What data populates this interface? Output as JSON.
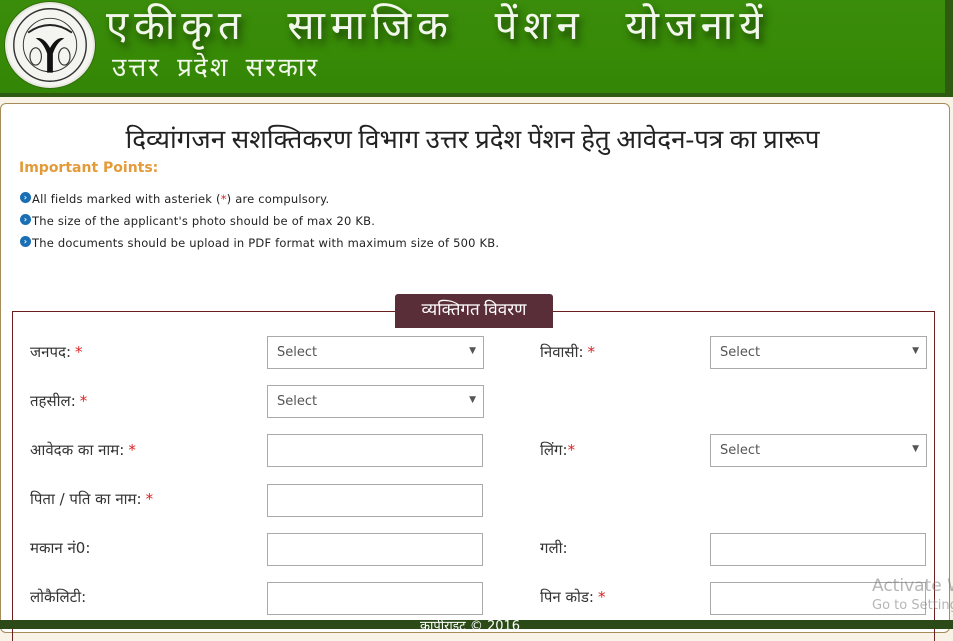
{
  "header": {
    "title": "एकीकृत सामाजिक पेंशन योजनायें",
    "subtitle": "उत्तर प्रदेश सरकार",
    "emblem": "up-government-emblem"
  },
  "page": {
    "title": "दिव्यांगजन सशक्तिकरण विभाग उत्तर प्रदेश पेंशन हेतु आवेदन-पत्र का प्रारूप"
  },
  "important_points": {
    "heading": "Important Points:",
    "bullet_icon": "chevron-right-circle-icon",
    "items": [
      {
        "before": "All fields marked with asteriek ( ",
        "star": "*",
        "after": " ) are compulsory."
      },
      {
        "before": "The size of the applicant's photo should be of max 20 KB.",
        "star": "",
        "after": ""
      },
      {
        "before": "The documents should be upload in PDF format with maximum size of 500 KB.",
        "star": "",
        "after": ""
      }
    ]
  },
  "section": {
    "legend": "व्यक्तिगत विवरण",
    "required_marker": "*",
    "caret": "▼",
    "fields": {
      "janpad": {
        "label": "जनपद:",
        "type": "select",
        "value": "Select",
        "required": true
      },
      "niwasi": {
        "label": "निवासी:",
        "type": "select",
        "value": "Select",
        "required": true
      },
      "tehsil": {
        "label": "तहसील:",
        "type": "select",
        "value": "Select",
        "required": true
      },
      "applicant_name": {
        "label": "आवेदक का नाम:",
        "type": "text",
        "value": "",
        "required": true
      },
      "gender": {
        "label": "लिंग:",
        "type": "select",
        "value": "Select",
        "required": true
      },
      "father_husband_name": {
        "label": "पिता / पति का नाम:",
        "type": "text",
        "value": "",
        "required": true
      },
      "house_no": {
        "label": "मकान नं0:",
        "type": "text",
        "value": "",
        "required": false
      },
      "street": {
        "label": "गली:",
        "type": "text",
        "value": "",
        "required": false
      },
      "locality": {
        "label": "लोकैलिटी:",
        "type": "text",
        "value": "",
        "required": false
      },
      "pin_code": {
        "label": "पिन कोड:",
        "type": "text",
        "value": "",
        "required": true
      }
    }
  },
  "footer": {
    "copyright": "कापीराइट © 2016"
  },
  "watermark": {
    "line1": "Activate Windows",
    "line2": "Go to Settings to activate Windows."
  }
}
